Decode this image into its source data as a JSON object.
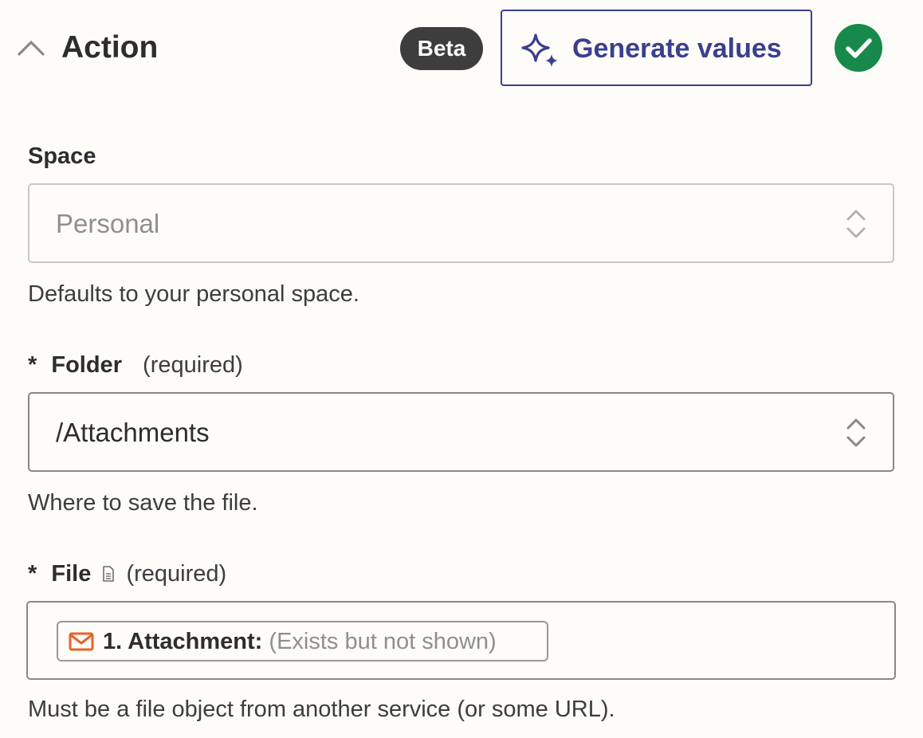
{
  "header": {
    "title": "Action",
    "badge": "Beta",
    "generate_label": "Generate values"
  },
  "fields": {
    "space": {
      "label": "Space",
      "value": "Personal",
      "help": "Defaults to your personal space."
    },
    "folder": {
      "marker": "*",
      "label": "Folder",
      "required": "(required)",
      "value": "/Attachments",
      "help": "Where to save the file."
    },
    "file": {
      "marker": "*",
      "label": "File",
      "required": "(required)",
      "pill_label": "1. Attachment:",
      "pill_value": "(Exists but not shown)",
      "help": "Must be a file object from another service (or some URL)."
    }
  },
  "colors": {
    "accent": "#3b3f8f",
    "success": "#17894a",
    "badge": "#3d3d3d",
    "mail_icon": "#e8642c"
  },
  "icons": {
    "collapse": "chevron-up-icon",
    "generate": "sparkle-icon",
    "status": "check-circle-icon",
    "select": "chevron-up-down-icon",
    "file_info": "document-icon",
    "source_app": "mail-icon"
  }
}
